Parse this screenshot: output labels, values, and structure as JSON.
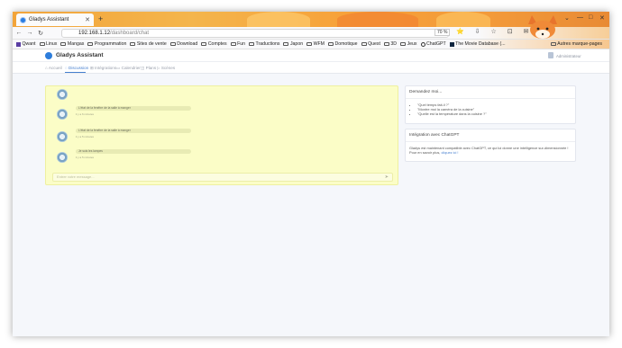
{
  "browser": {
    "tab_title": "Gladys Assistant",
    "tab_close": "✕",
    "new_tab": "+",
    "url_host": "192.168.1.12",
    "url_path": "/dashboard/chat",
    "zoom": "70 %",
    "window_controls": [
      "⌄",
      "—",
      "□",
      "✕"
    ],
    "nav_icons": [
      "⭐",
      "⇩",
      "☆",
      "⊡",
      "✉",
      "≡"
    ],
    "bookmarks": [
      "Qwant",
      "Linux",
      "Mangas",
      "Programmation",
      "Sites de vente",
      "Download",
      "Comptes",
      "Fun",
      "Traductions",
      "Japon",
      "WFM",
      "Domotique",
      "Quest",
      "3D",
      "Jeux",
      "ChatGPT",
      "The Movie Database (..."
    ],
    "other_bookmarks": "Autres marque-pages"
  },
  "app": {
    "brand": "Gladys Assistant",
    "username": "Administrateur",
    "nav": [
      {
        "label": "Accueil",
        "icon": "home-icon"
      },
      {
        "label": "Discussion",
        "icon": "chat-icon"
      },
      {
        "label": "Intégrations",
        "icon": "grid-icon"
      },
      {
        "label": "Calendrier",
        "icon": "calendar-icon"
      },
      {
        "label": "Plans",
        "icon": "map-icon"
      },
      {
        "label": "Scènes",
        "icon": "play-icon"
      }
    ]
  },
  "chat": {
    "messages": [
      {
        "text": "",
        "time": ""
      },
      {
        "text": "L'état de la fenêtre de la salle à manger",
        "time": "il y a 6 minutes"
      },
      {
        "text": "L'état de la fenêtre de la salle à manger",
        "time": "il y a 5 minutes"
      },
      {
        "text": "Je suis les lampes",
        "time": "il y a 5 minutes"
      }
    ],
    "input_placeholder": "Entrer votre message...",
    "send_icon": "➤"
  },
  "ask_card": {
    "title": "Demandez moi...",
    "items": [
      "\"Quel temps fait-il ?\"",
      "\"Montre moi la caméra de la cuisine\"",
      "\"Quelle est la température dans la cuisine ?\""
    ]
  },
  "chatgpt_card": {
    "title": "Intégration avec ChatGPT",
    "body": "Gladys est maintenant compatible avec ChatGPT, ce qui lui donne une intelligence sur-dimensionnée ! Pour en savoir plus,",
    "link": "cliquez ici !"
  }
}
